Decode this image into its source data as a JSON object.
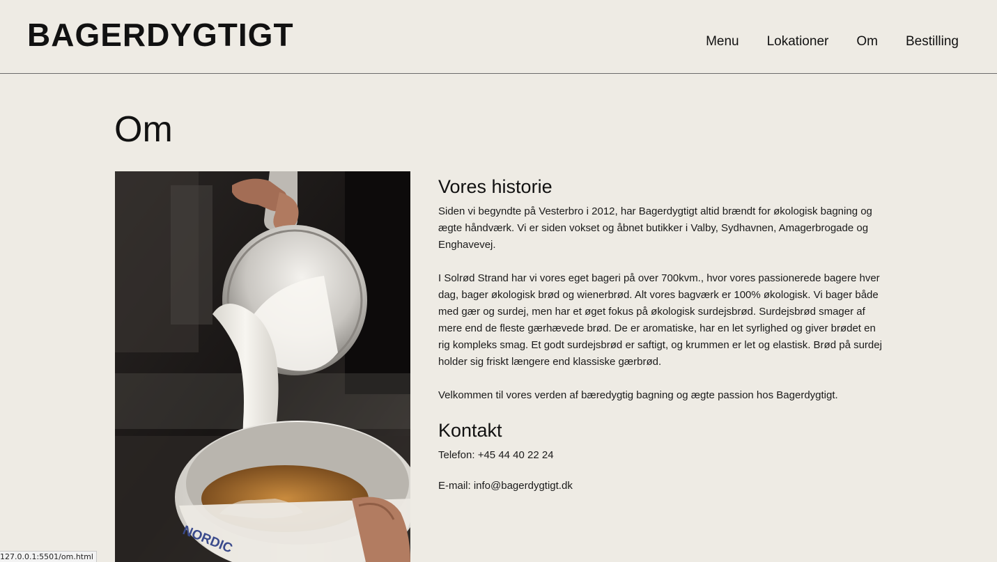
{
  "header": {
    "logo": "BAGERDYGTIGT",
    "nav": [
      "Menu",
      "Lokationer",
      "Om",
      "Bestilling"
    ]
  },
  "main": {
    "title": "Om",
    "image": {
      "icon": "latte-pouring-photo",
      "cup_text": "NORDIC"
    },
    "history": {
      "heading": "Vores historie",
      "paragraphs": [
        "Siden vi begyndte på Vesterbro i 2012, har Bagerdygtigt altid brændt for økologisk bagning og ægte håndværk. Vi er siden vokset og åbnet butikker i Valby, Sydhavnen, Amagerbrogade og Enghavevej.",
        "I Solrød Strand har vi vores eget bageri på over 700kvm., hvor vores passionerede bagere hver dag, bager økologisk brød og wienerbrød. Alt vores bagværk er 100% økologisk. Vi bager både med gær og surdej, men har et øget fokus på økologisk surdejsbrød. Surdejsbrød smager af mere end de fleste gærhævede brød. De er aromatiske, har en let syrlighed og giver brødet en rig kompleks smag. Et godt surdejsbrød er saftigt, og krummen er let og elastisk. Brød på surdej holder sig friskt længere end klassiske gærbrød.",
        "Velkommen til vores verden af bæredygtig bagning og ægte passion hos Bagerdygtigt."
      ]
    },
    "contact": {
      "heading": "Kontakt",
      "phone": "Telefon: +45 44 40 22 24",
      "email": "E-mail: info@bagerdygtigt.dk"
    }
  },
  "status_bar": {
    "url": "127.0.0.1:5501/om.html"
  },
  "colors": {
    "background": "#eeebe4",
    "text": "#111111",
    "divider": "#6b6b6b"
  }
}
